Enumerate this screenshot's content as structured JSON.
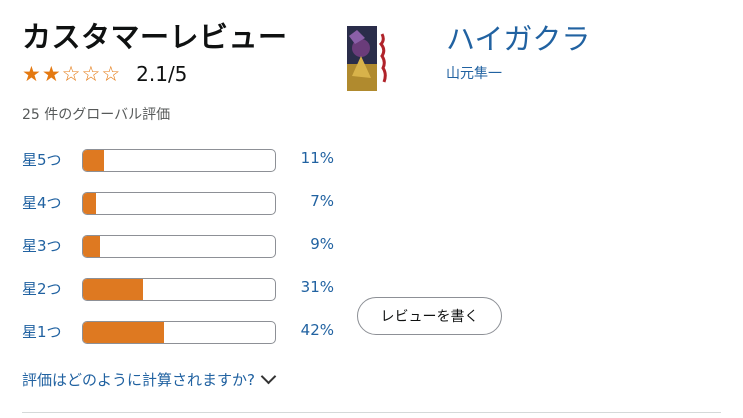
{
  "header": {
    "title": "カスタマーレビュー",
    "score_text": "2.1/5",
    "rating_value": 2.1,
    "rating_max": 5,
    "global_count": "25 件のグローバル評価"
  },
  "histogram": [
    {
      "label": "星5つ",
      "pct_text": "11%",
      "pct": 11
    },
    {
      "label": "星4つ",
      "pct_text": "7%",
      "pct": 7
    },
    {
      "label": "星3つ",
      "pct_text": "9%",
      "pct": 9
    },
    {
      "label": "星2つ",
      "pct_text": "31%",
      "pct": 31
    },
    {
      "label": "星1つ",
      "pct_text": "42%",
      "pct": 42
    }
  ],
  "how_calculated": "評価はどのように計算されますか?",
  "product": {
    "title": "ハイガクラ",
    "author": "山元隼一"
  },
  "write_review_label": "レビューを書く",
  "colors": {
    "link": "#2162a1",
    "bar_fill": "#de7921",
    "star": "#e47911"
  },
  "icons": {
    "expand": "chevron-down-icon"
  }
}
